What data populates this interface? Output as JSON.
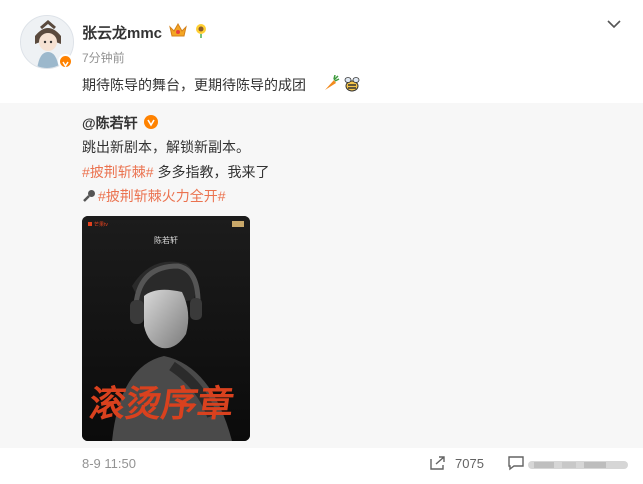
{
  "post": {
    "author": "张云龙mmc",
    "time_ago": "7分钟前",
    "text": "期待陈导的舞台，更期待陈导的成团",
    "emoji": [
      "carrot-icon",
      "bee-icon"
    ]
  },
  "repost": {
    "author": "@陈若轩",
    "lines": {
      "l1": "跳出新剧本，解锁新副本。",
      "l2_tag": "#披荆斩棘#",
      "l2_rest": " 多多指教，我来了",
      "l3_tag": "#披荆斩棘火力全开#"
    },
    "poster": {
      "logo": "芒果tv",
      "name": "陈若轩",
      "title": "滚烫序章"
    }
  },
  "footer": {
    "datetime": "8-9 11:50",
    "share_count": "7075"
  },
  "colors": {
    "accent": "#eb7350",
    "verified": "#ff8200",
    "muted": "#939393",
    "repost_bg": "#f7f7f7"
  }
}
